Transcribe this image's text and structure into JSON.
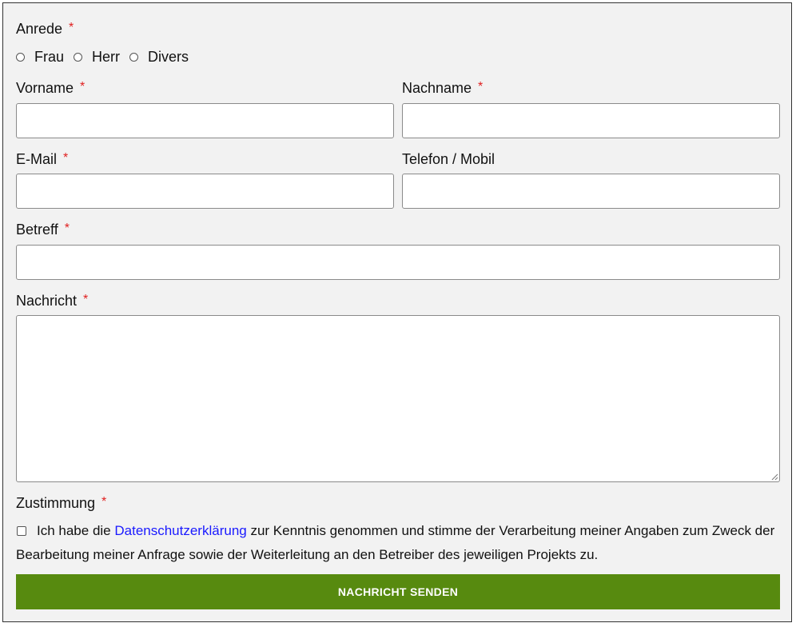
{
  "form": {
    "salutation": {
      "label": "Anrede",
      "required_mark": "*",
      "options": [
        "Frau",
        "Herr",
        "Divers"
      ]
    },
    "first_name": {
      "label": "Vorname",
      "required_mark": "*",
      "value": ""
    },
    "last_name": {
      "label": "Nachname",
      "required_mark": "*",
      "value": ""
    },
    "email": {
      "label": "E-Mail",
      "required_mark": "*",
      "value": ""
    },
    "phone": {
      "label": "Telefon / Mobil",
      "value": ""
    },
    "subject": {
      "label": "Betreff",
      "required_mark": "*",
      "value": ""
    },
    "message": {
      "label": "Nachricht",
      "required_mark": "*",
      "value": ""
    },
    "consent": {
      "label": "Zustimmung",
      "required_mark": "*",
      "text_before": "Ich habe die ",
      "link_text": "Datenschutzerklärung",
      "text_after": " zur Kenntnis genommen und stimme der Verarbeitung meiner Angaben zum Zweck der Bearbeitung meiner Anfrage sowie der Weiterleitung an den Betreiber des jeweiligen Projekts zu.",
      "checked": false
    },
    "submit_label": "NACHRICHT SENDEN"
  },
  "colors": {
    "background": "#f2f2f2",
    "required": "#e02020",
    "link": "#1a1aff",
    "submit": "#578a0f"
  }
}
